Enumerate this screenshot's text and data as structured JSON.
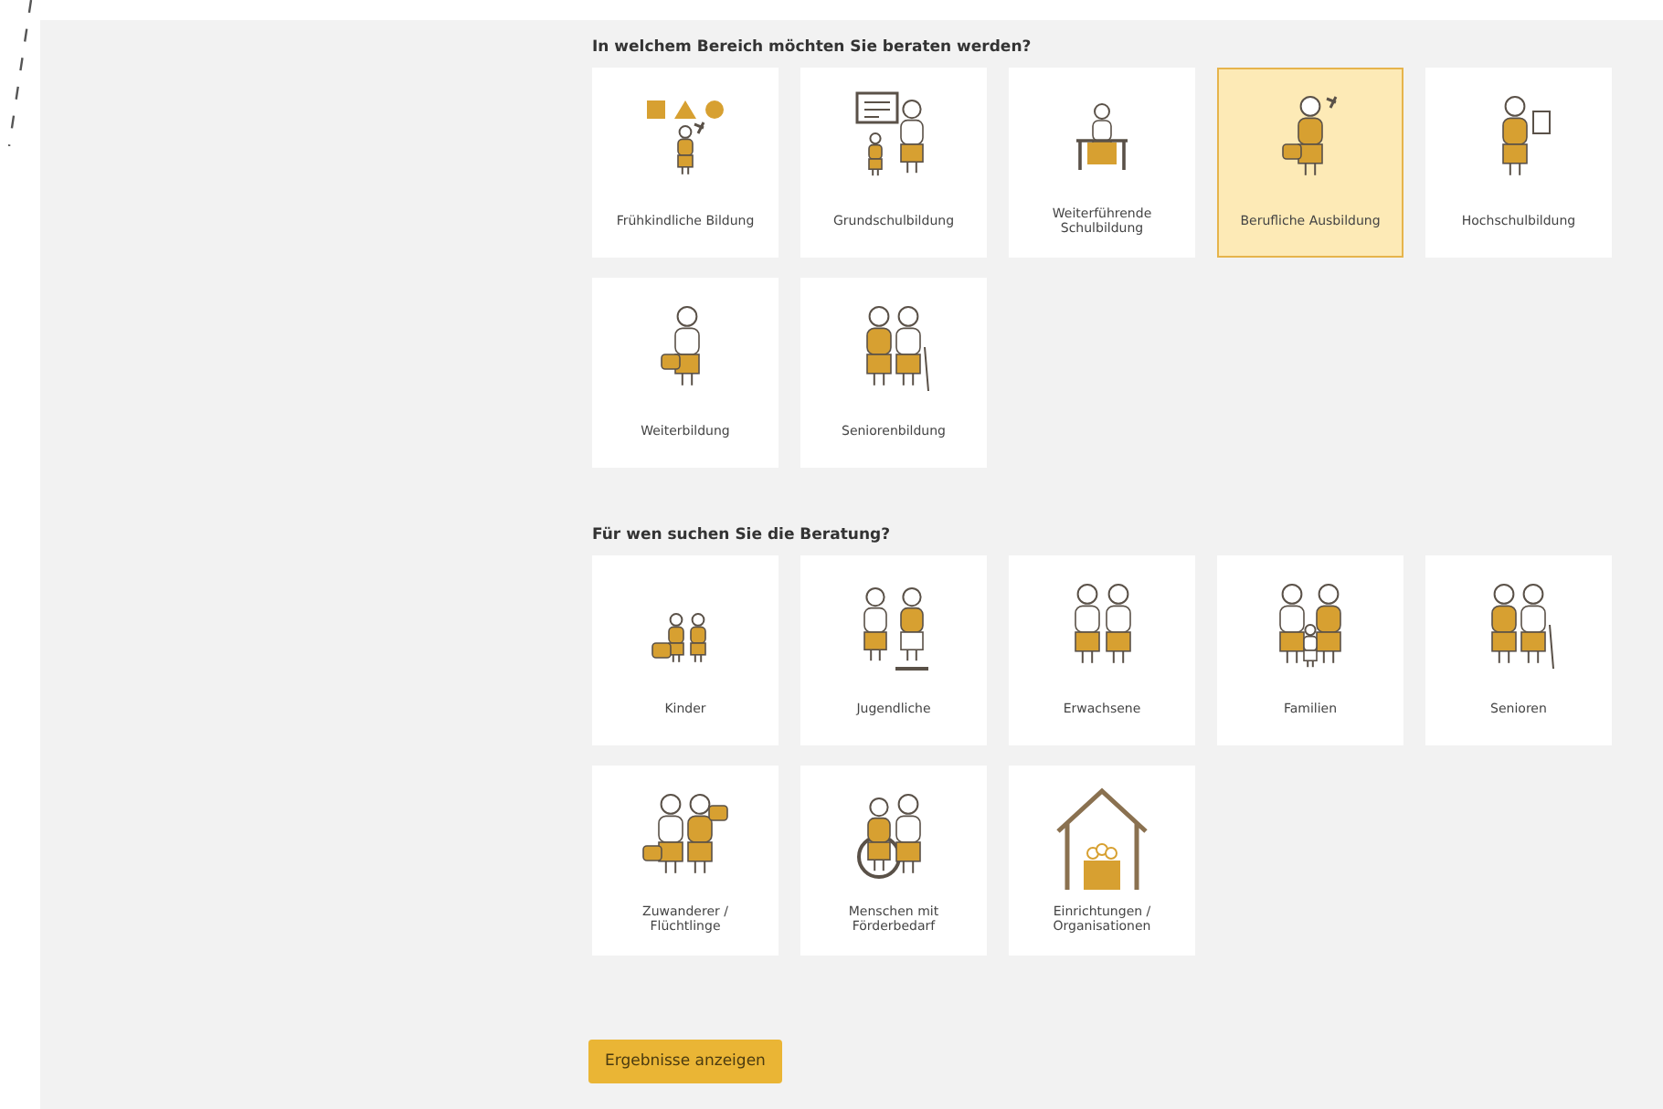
{
  "sections": [
    {
      "heading": "In welchem Bereich möchten Sie beraten werden?",
      "options": [
        {
          "label": "Frühkindliche Bildung",
          "selected": false
        },
        {
          "label": "Grundschulbildung",
          "selected": false
        },
        {
          "label": "Weiterführende Schulbildung",
          "selected": false
        },
        {
          "label": "Berufliche Ausbildung",
          "selected": true
        },
        {
          "label": "Hochschulbildung",
          "selected": false
        },
        {
          "label": "Weiterbildung",
          "selected": false
        },
        {
          "label": "Seniorenbildung",
          "selected": false
        }
      ]
    },
    {
      "heading": "Für wen suchen Sie die Beratung?",
      "options": [
        {
          "label": "Kinder",
          "selected": false
        },
        {
          "label": "Jugendliche",
          "selected": false
        },
        {
          "label": "Erwachsene",
          "selected": false
        },
        {
          "label": "Familien",
          "selected": false
        },
        {
          "label": "Senioren",
          "selected": false
        },
        {
          "label": "Zuwanderer / Flüchtlinge",
          "selected": false
        },
        {
          "label": "Menschen mit Förderbedarf",
          "selected": false
        },
        {
          "label": "Einrichtungen / Organisationen",
          "selected": false
        }
      ]
    }
  ],
  "submit": {
    "label": "Ergebnisse anzeigen"
  }
}
